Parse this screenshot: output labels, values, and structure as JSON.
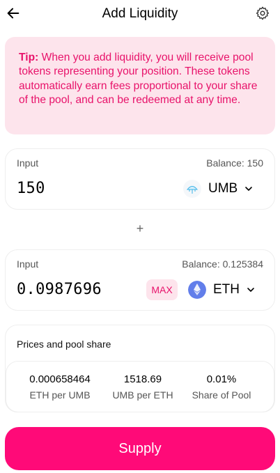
{
  "header": {
    "title": "Add Liquidity"
  },
  "tip": {
    "label": "Tip:",
    "text": " When you add liquidity, you will receive pool tokens representing your position. These tokens automatically earn fees proportional to your share of the pool, and can be redeemed at any time."
  },
  "input1": {
    "label": "Input",
    "balance": "Balance: 150",
    "amount": "150",
    "token": "UMB"
  },
  "input2": {
    "label": "Input",
    "balance": "Balance: 0.125384",
    "amount": "0.0987696",
    "token": "ETH",
    "max_label": "MAX"
  },
  "plus": "+",
  "prices": {
    "title": "Prices and pool share",
    "stats": [
      {
        "value": "0.000658464",
        "label": "ETH per UMB"
      },
      {
        "value": "1518.69",
        "label": "UMB per ETH"
      },
      {
        "value": "0.01%",
        "label": "Share of Pool"
      }
    ]
  },
  "supply_label": "Supply",
  "colors": {
    "accent": "#ff0a78",
    "tip_bg": "#fde4ec",
    "tip_text": "#e8126a",
    "eth": "#627eea"
  }
}
